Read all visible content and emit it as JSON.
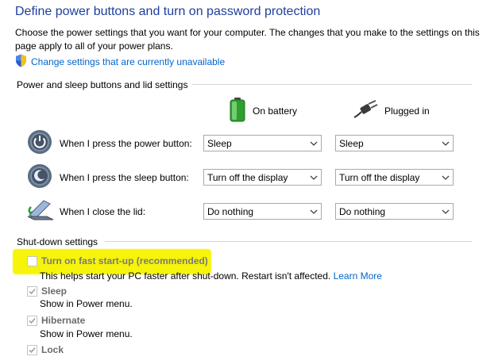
{
  "header": {
    "title": "Define power buttons and turn on password protection",
    "description": "Choose the power settings that you want for your computer. The changes that you make to the settings on this page apply to all of your power plans.",
    "change_link": "Change settings that are currently unavailable"
  },
  "power_section": {
    "title": "Power and sleep buttons and lid settings",
    "columns": {
      "battery": "On battery",
      "plugged": "Plugged in"
    },
    "rows": [
      {
        "label": "When I press the power button:",
        "battery": "Sleep",
        "plugged": "Sleep",
        "icon": "power-button-icon"
      },
      {
        "label": "When I press the sleep button:",
        "battery": "Turn off the display",
        "plugged": "Turn off the display",
        "icon": "sleep-button-icon"
      },
      {
        "label": "When I close the lid:",
        "battery": "Do nothing",
        "plugged": "Do nothing",
        "icon": "laptop-lid-icon"
      }
    ]
  },
  "shutdown_section": {
    "title": "Shut-down settings",
    "fast_startup": {
      "label": "Turn on fast start-up (recommended)",
      "checked": false,
      "help": "This helps start your PC faster after shut-down. Restart isn't affected.",
      "learn_more": "Learn More"
    },
    "sleep": {
      "label": "Sleep",
      "checked": true,
      "help": "Show in Power menu."
    },
    "hibernate": {
      "label": "Hibernate",
      "checked": true,
      "help": "Show in Power menu."
    },
    "lock": {
      "label": "Lock",
      "checked": true
    }
  },
  "colors": {
    "title_blue": "#1e3f9c",
    "link_blue": "#0066cc",
    "highlight_yellow": "#f6f40a"
  }
}
